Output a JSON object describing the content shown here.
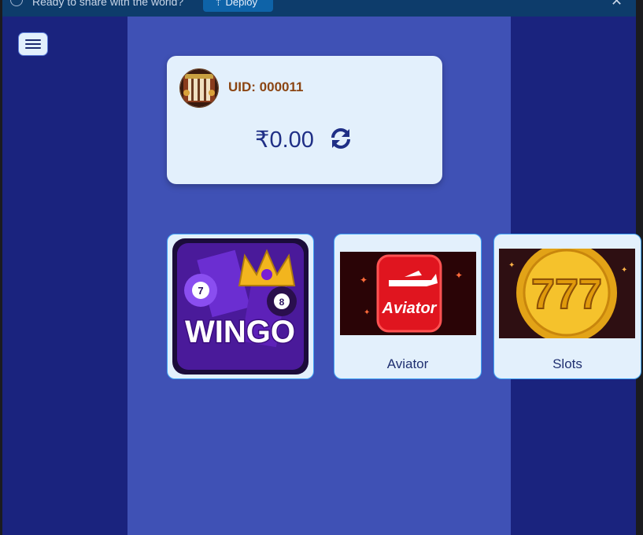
{
  "banner": {
    "message": "Ready to share with the world?",
    "deploy_label": "Deploy",
    "close_glyph": "✕"
  },
  "wallet": {
    "uid_label": "UID: 000011",
    "balance": "₹0.00"
  },
  "games": [
    {
      "label": "Wingo",
      "logo_text": "WINGO"
    },
    {
      "label": "Aviator",
      "logo_text": "Aviator"
    },
    {
      "label": "Slots",
      "logo_text": "777"
    }
  ],
  "colors": {
    "page_bg": "#1a237e",
    "main_bg": "#3f51b5",
    "card_bg": "#e3f0fc",
    "uid_color": "#8b4513",
    "balance_color": "#1f2f86"
  },
  "icons": [
    "info-icon",
    "deploy-icon",
    "close-icon",
    "menu-icon",
    "refresh-icon",
    "avatar"
  ]
}
